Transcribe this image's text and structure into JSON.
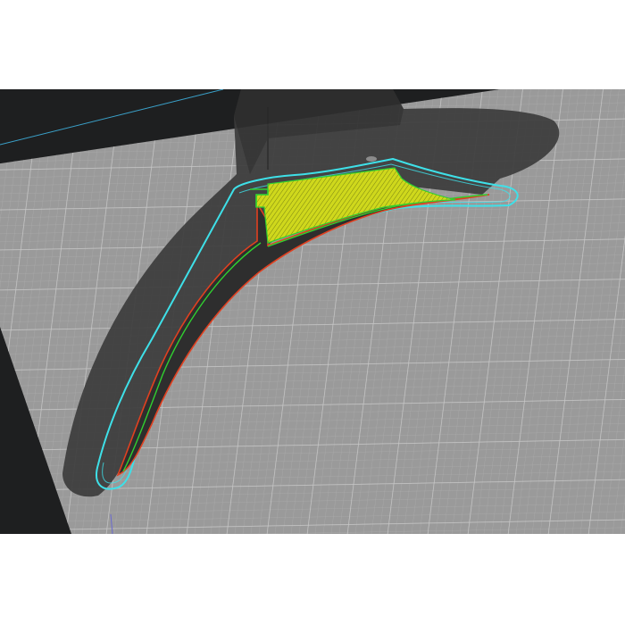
{
  "viewer": {
    "background_color": "#1e1f20",
    "bed_color": "#9a9a9a",
    "bed_grid_minor_color": "#a8a8a8",
    "bed_grid_major_color": "#c4c4c4",
    "bed_border_color": "#3aa0c8",
    "model_color": "#3c3c3c",
    "model_shadow_color": "#2a2a2a",
    "skirt_color": "#3ee0e8",
    "outer_wall_color": "#e04020",
    "inner_wall_color": "#30d030",
    "infill_color": "#d8e020"
  }
}
